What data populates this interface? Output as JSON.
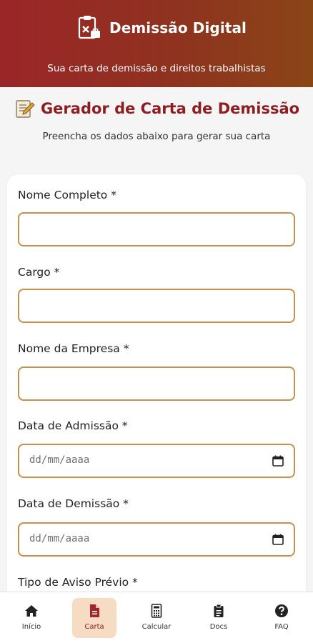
{
  "header": {
    "title": "Demissão Digital",
    "subtitle": "Sua carta de demissão e direitos trabalhistas"
  },
  "page": {
    "title": "Gerador de Carta de Demissão",
    "description": "Preencha os dados abaixo para gerar sua carta"
  },
  "form": {
    "fields": [
      {
        "label": "Nome Completo *",
        "value": ""
      },
      {
        "label": "Cargo *",
        "value": ""
      },
      {
        "label": "Nome da Empresa *",
        "value": ""
      },
      {
        "label": "Data de Admissão *",
        "placeholder": "dd/mm/aaaa"
      },
      {
        "label": "Data de Demissão *",
        "placeholder": "dd/mm/aaaa"
      },
      {
        "label": "Tipo de Aviso Prévio *"
      }
    ]
  },
  "nav": {
    "items": [
      {
        "label": "Início",
        "icon": "home-icon"
      },
      {
        "label": "Carta",
        "icon": "document-icon",
        "active": true
      },
      {
        "label": "Calcular",
        "icon": "calculator-icon"
      },
      {
        "label": "Docs",
        "icon": "clipboard-icon"
      },
      {
        "label": "FAQ",
        "icon": "question-icon"
      }
    ]
  },
  "colors": {
    "header_start": "#9b2628",
    "header_end": "#8a4516",
    "title": "#8f1e22",
    "field_border": "#c7904f",
    "active_nav_bg": "#f7dcc4"
  }
}
